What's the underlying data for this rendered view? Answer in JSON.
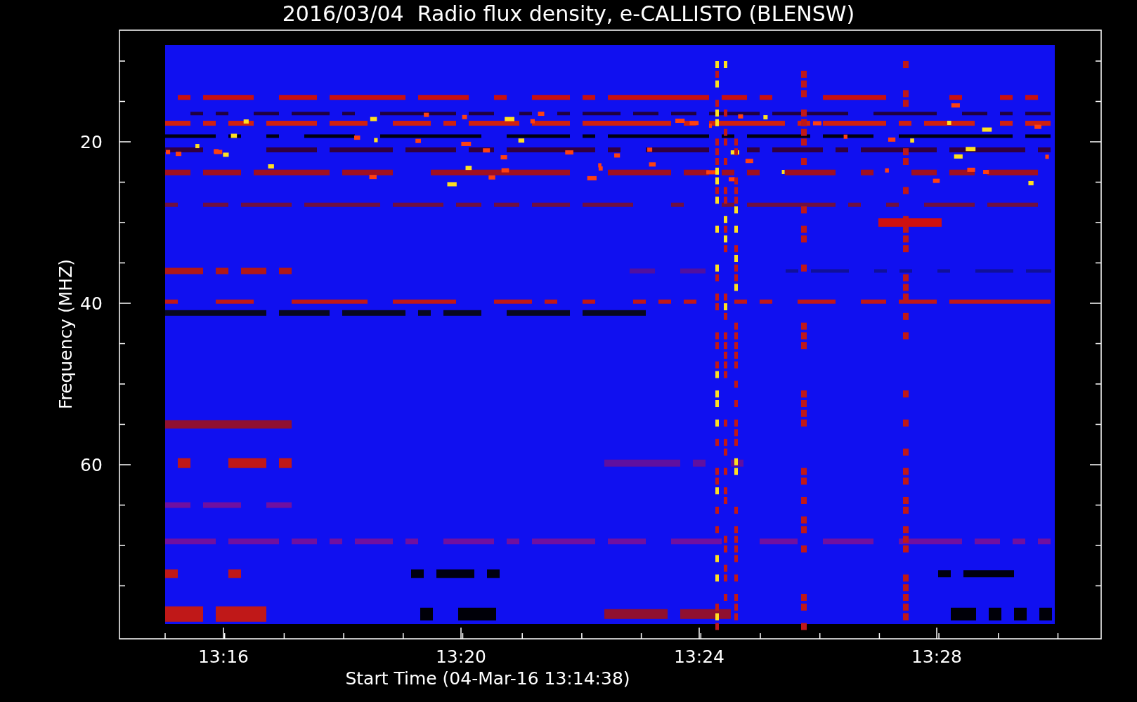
{
  "plot": {
    "title": "2016/03/04  Radio flux density, e-CALLISTO (BLENSW)",
    "xlabel": "Start Time (04-Mar-16 13:14:38)",
    "ylabel": "Frequency (MHZ)",
    "xtick_labels": [
      "13:16",
      "13:20",
      "13:24",
      "13:28"
    ],
    "ytick_labels": [
      "20",
      "40",
      "60"
    ]
  }
}
